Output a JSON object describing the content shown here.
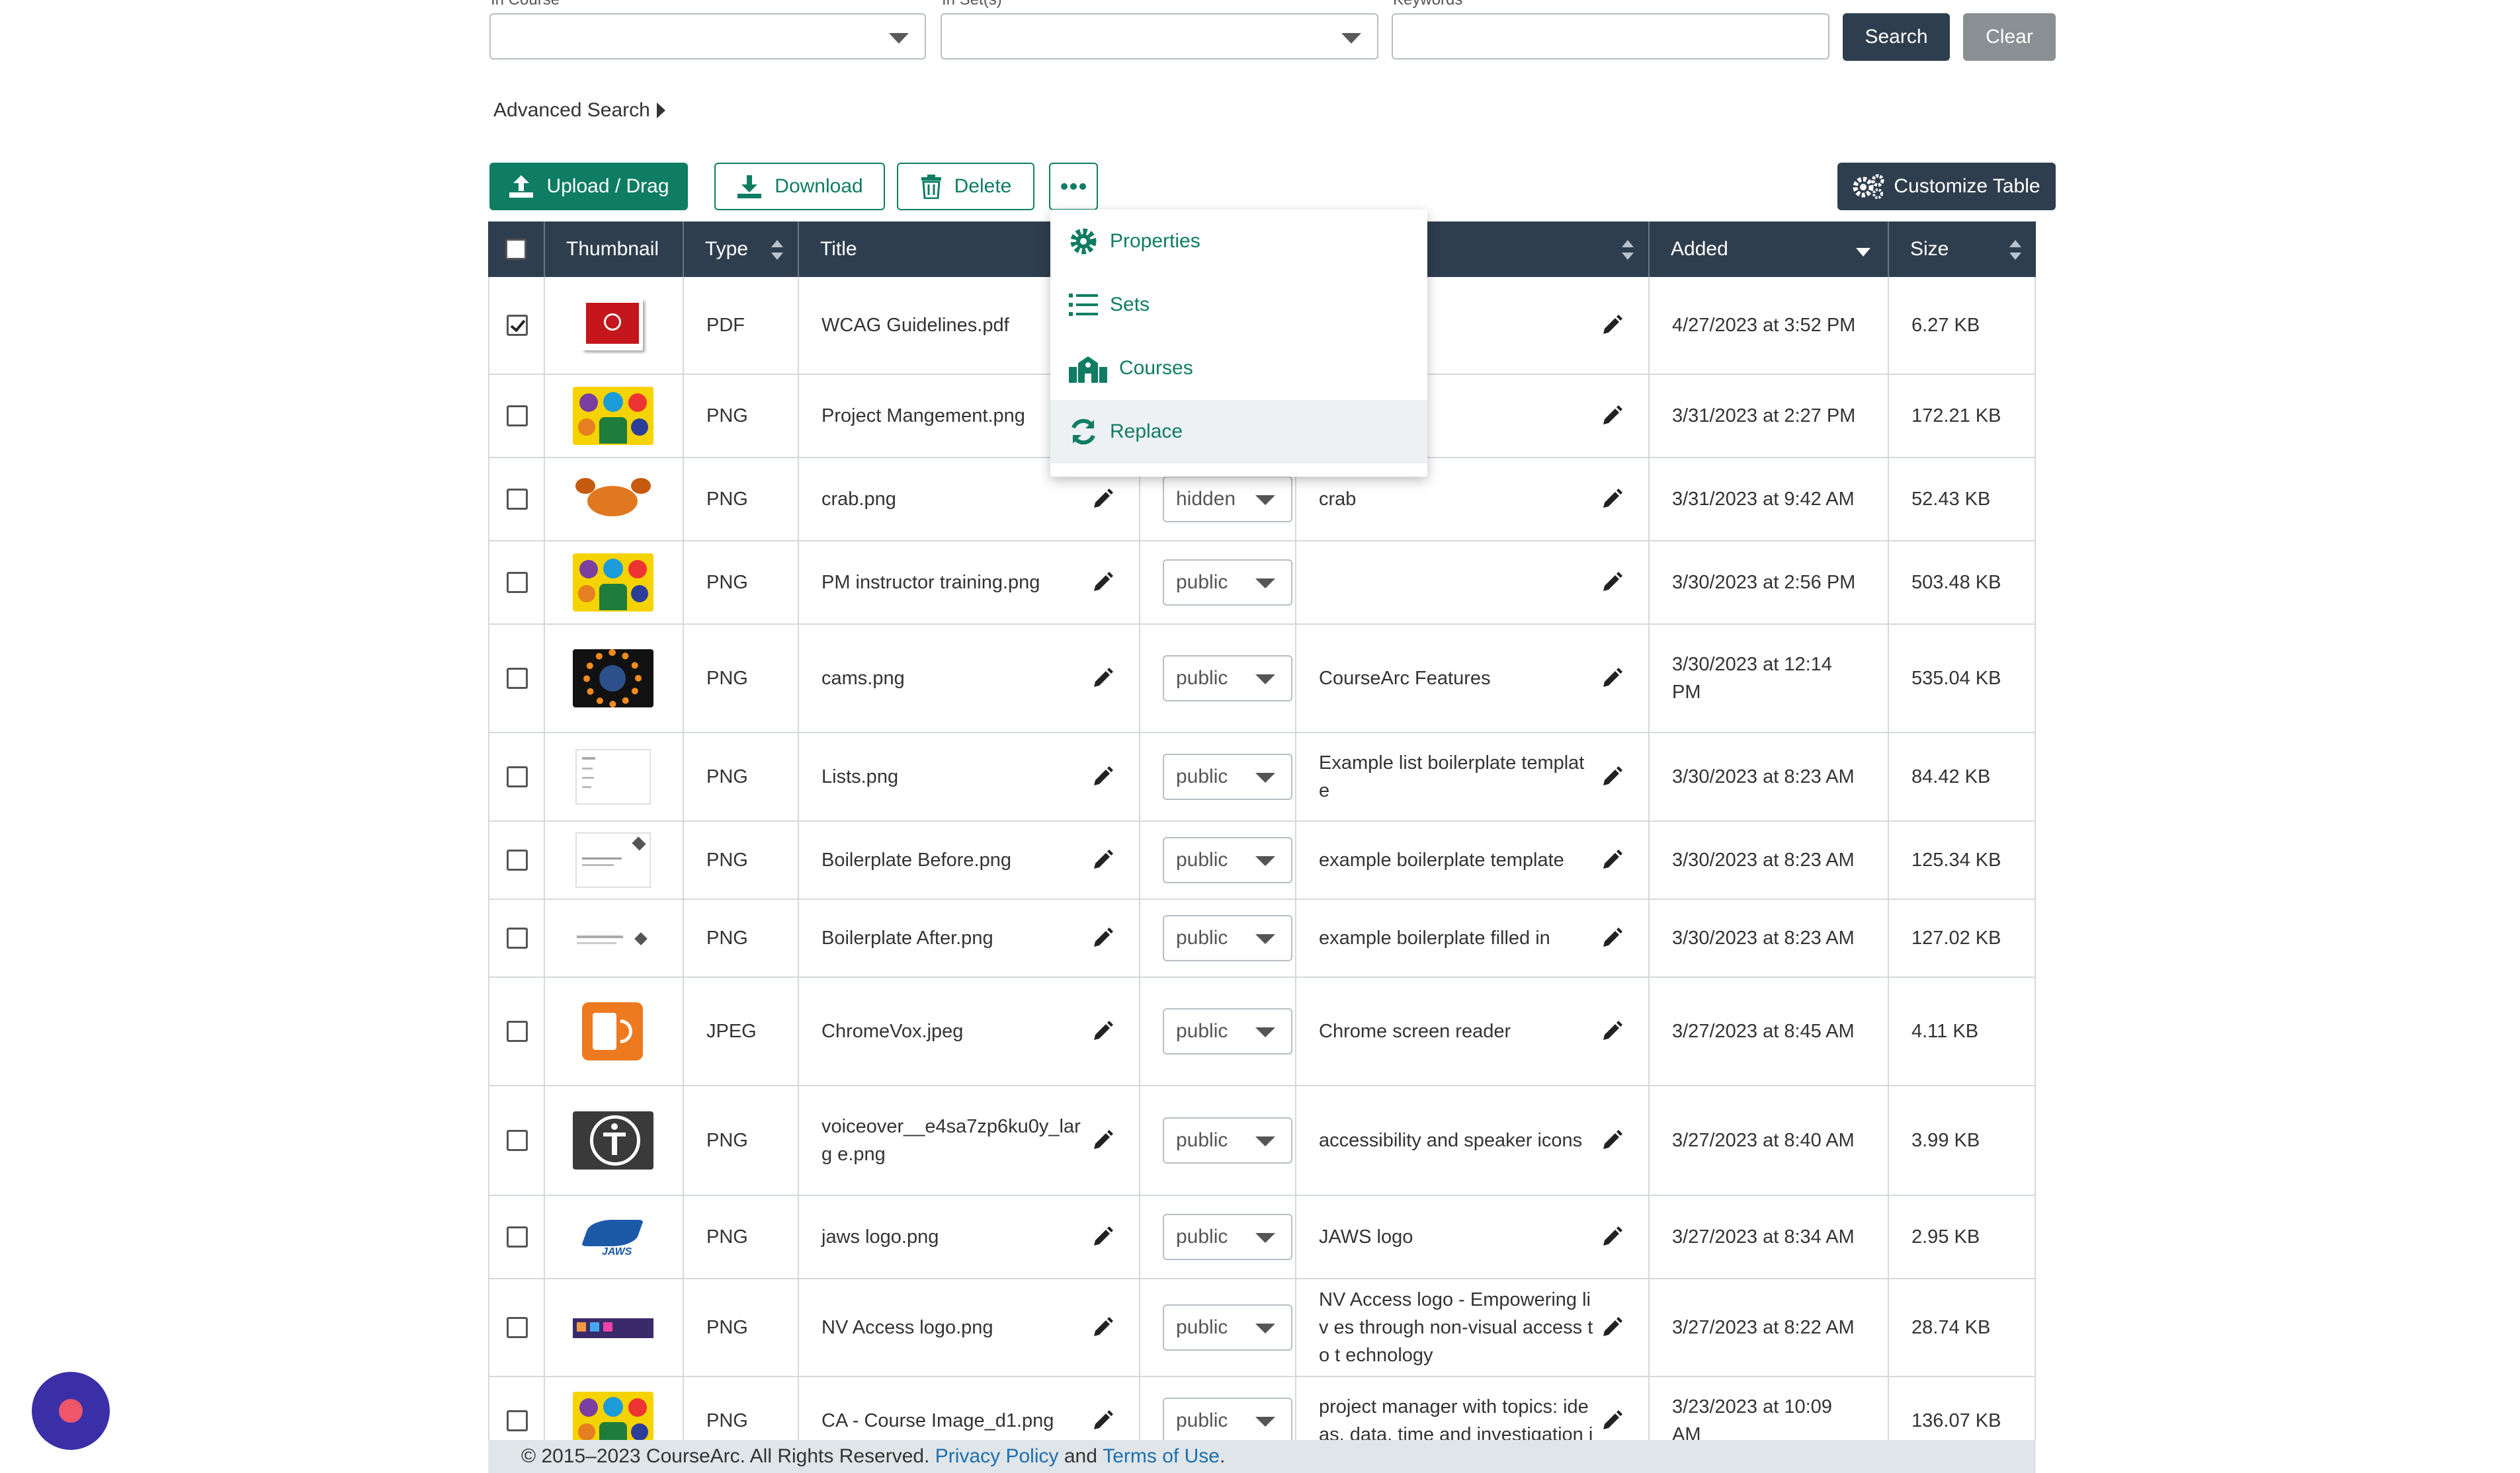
{
  "filters": {
    "course_label": "In Course",
    "sets_label": "In Set(s)",
    "keywords_label": "Keywords",
    "keywords_value": "",
    "search_button": "Search",
    "clear_button": "Clear",
    "advanced_search": "Advanced Search"
  },
  "toolbar": {
    "upload": "Upload / Drag",
    "download": "Download",
    "delete": "Delete",
    "customize": "Customize Table"
  },
  "menu": {
    "items": [
      "Properties",
      "Sets",
      "Courses",
      "Replace"
    ]
  },
  "table": {
    "headers": {
      "thumbnail": "Thumbnail",
      "type": "Type",
      "title": "Title",
      "added": "Added",
      "size": "Size"
    },
    "rows": [
      {
        "checked": true,
        "thumb": "pdf",
        "type": "PDF",
        "title": "WCAG Guidelines.pdf",
        "visibility": "",
        "description": "",
        "added": "4/27/2023 at 3:52 PM",
        "size": "6.27 KB"
      },
      {
        "checked": false,
        "thumb": "people",
        "type": "PNG",
        "title": "Project Mangement.png",
        "visibility": "",
        "description": "",
        "added": "3/31/2023 at 2:27 PM",
        "size": "172.21 KB"
      },
      {
        "checked": false,
        "thumb": "crab",
        "type": "PNG",
        "title": "crab.png",
        "visibility": "hidden",
        "description": "crab",
        "added": "3/31/2023 at 9:42 AM",
        "size": "52.43 KB"
      },
      {
        "checked": false,
        "thumb": "people",
        "type": "PNG",
        "title": "PM instructor training.png",
        "visibility": "public",
        "description": "",
        "added": "3/30/2023 at 2:56 PM",
        "size": "503.48 KB"
      },
      {
        "checked": false,
        "thumb": "cams",
        "type": "PNG",
        "title": "cams.png",
        "visibility": "public",
        "description": "CourseArc Features",
        "added": "3/30/2023 at 12:14 PM",
        "size": "535.04 KB"
      },
      {
        "checked": false,
        "thumb": "doc",
        "type": "PNG",
        "title": "Lists.png",
        "visibility": "public",
        "description": "Example list boilerplate templat e",
        "added": "3/30/2023 at 8:23 AM",
        "size": "84.42 KB"
      },
      {
        "checked": false,
        "thumb": "doc2",
        "type": "PNG",
        "title": "Boilerplate Before.png",
        "visibility": "public",
        "description": "example boilerplate template",
        "added": "3/30/2023 at 8:23 AM",
        "size": "125.34 KB"
      },
      {
        "checked": false,
        "thumb": "doc3",
        "type": "PNG",
        "title": "Boilerplate After.png",
        "visibility": "public",
        "description": "example boilerplate filled in",
        "added": "3/30/2023 at 8:23 AM",
        "size": "127.02 KB"
      },
      {
        "checked": false,
        "thumb": "chromevox",
        "type": "JPEG",
        "title": "ChromeVox.jpeg",
        "visibility": "public",
        "description": "Chrome screen reader",
        "added": "3/27/2023 at 8:45 AM",
        "size": "4.11 KB"
      },
      {
        "checked": false,
        "thumb": "voiceover",
        "type": "PNG",
        "title": "voiceover__e4sa7zp6ku0y_larg e.png",
        "visibility": "public",
        "description": "accessibility and speaker icons",
        "added": "3/27/2023 at 8:40 AM",
        "size": "3.99 KB"
      },
      {
        "checked": false,
        "thumb": "jaws",
        "type": "PNG",
        "title": "jaws logo.png",
        "visibility": "public",
        "description": "JAWS logo",
        "added": "3/27/2023 at 8:34 AM",
        "size": "2.95 KB"
      },
      {
        "checked": false,
        "thumb": "nv",
        "type": "PNG",
        "title": "NV Access logo.png",
        "visibility": "public",
        "description": "NV Access logo - Empowering liv es through non-visual access to t echnology",
        "added": "3/27/2023 at 8:22 AM",
        "size": "28.74 KB"
      },
      {
        "checked": false,
        "thumb": "people",
        "type": "PNG",
        "title": "CA - Course Image_d1.png",
        "visibility": "public",
        "description": "project manager with topics: ide as, data, time and investigation i",
        "added": "3/23/2023 at 10:09 AM",
        "size": "136.07 KB"
      }
    ]
  },
  "footer": {
    "copyright": "© 2015–2023 CourseArc. All Rights Reserved.",
    "privacy": "Privacy Policy",
    "and": "and",
    "terms": "Terms of Use",
    "period": "."
  },
  "colors": {
    "header": "#2f3e4e",
    "accent": "#0f7d63",
    "link": "#1c6fb0"
  }
}
